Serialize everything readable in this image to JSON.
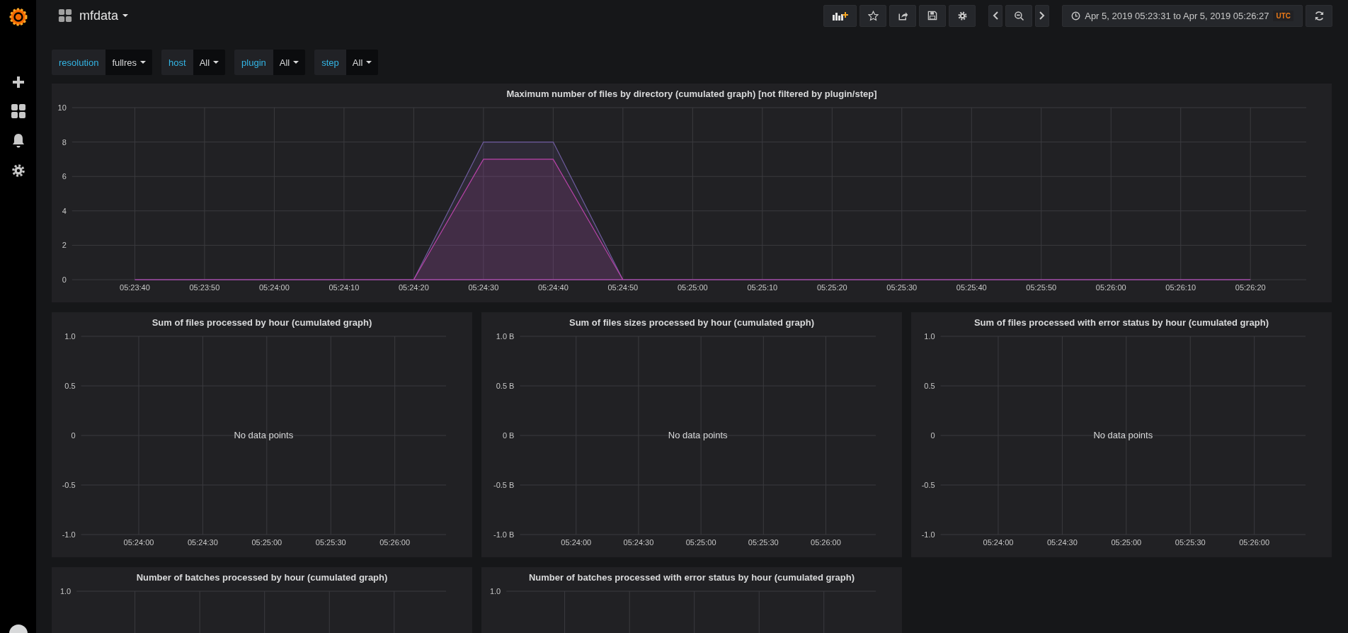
{
  "dashboard": {
    "title": "mfdata"
  },
  "toolbar": {
    "time_range": "Apr 5, 2019 05:23:31 to Apr 5, 2019 05:26:27",
    "timezone": "UTC"
  },
  "variables": [
    {
      "label": "resolution",
      "value": "fullres"
    },
    {
      "label": "host",
      "value": "All"
    },
    {
      "label": "plugin",
      "value": "All"
    },
    {
      "label": "step",
      "value": "All"
    }
  ],
  "panels": [
    {
      "title": "Maximum number of files by directory (cumulated graph) [not filtered by plugin/step]",
      "chart_data": {
        "type": "area",
        "grid": true,
        "categories": [
          "05:23:40",
          "05:23:50",
          "05:24:00",
          "05:24:10",
          "05:24:20",
          "05:24:30",
          "05:24:40",
          "05:24:50",
          "05:25:00",
          "05:25:10",
          "05:25:20",
          "05:25:30",
          "05:25:40",
          "05:25:50",
          "05:26:00",
          "05:26:10",
          "05:26:20"
        ],
        "ylim": [
          0,
          10
        ],
        "yticks": [
          0,
          2,
          4,
          6,
          8,
          10
        ],
        "series": [
          {
            "color": "#705da0",
            "values": [
              0,
              0,
              0,
              0,
              0,
              8,
              8,
              0,
              0,
              0,
              0,
              0,
              0,
              0,
              0,
              0,
              0
            ]
          },
          {
            "color": "#ba43a9",
            "values": [
              0,
              0,
              0,
              0,
              0,
              7,
              7,
              0,
              0,
              0,
              0,
              0,
              0,
              0,
              0,
              0,
              0
            ]
          }
        ]
      }
    },
    {
      "title": "Sum of files processed by hour (cumulated graph)",
      "message": "No data points",
      "chart_data": {
        "type": "line",
        "grid": true,
        "categories": [
          "05:24:00",
          "05:24:30",
          "05:25:00",
          "05:25:30",
          "05:26:00"
        ],
        "ylim": [
          -1,
          1
        ],
        "yticks": [
          {
            "value": 1,
            "label": "1.0"
          },
          {
            "value": 0.5,
            "label": "0.5"
          },
          {
            "value": 0,
            "label": "0"
          },
          {
            "value": -0.5,
            "label": "-0.5"
          },
          {
            "value": -1,
            "label": "-1.0"
          }
        ]
      }
    },
    {
      "title": "Sum of files sizes processed by hour (cumulated graph)",
      "message": "No data points",
      "chart_data": {
        "type": "line",
        "grid": true,
        "categories": [
          "05:24:00",
          "05:24:30",
          "05:25:00",
          "05:25:30",
          "05:26:00"
        ],
        "ylim": [
          -1,
          1
        ],
        "yticks": [
          {
            "value": 1,
            "label": "1.0 B"
          },
          {
            "value": 0.5,
            "label": "0.5 B"
          },
          {
            "value": 0,
            "label": "0 B"
          },
          {
            "value": -0.5,
            "label": "-0.5 B"
          },
          {
            "value": -1,
            "label": "-1.0 B"
          }
        ]
      }
    },
    {
      "title": "Sum of files processed with error status by hour (cumulated graph)",
      "message": "No data points",
      "chart_data": {
        "type": "line",
        "grid": true,
        "categories": [
          "05:24:00",
          "05:24:30",
          "05:25:00",
          "05:25:30",
          "05:26:00"
        ],
        "ylim": [
          -1,
          1
        ],
        "yticks": [
          {
            "value": 1,
            "label": "1.0"
          },
          {
            "value": 0.5,
            "label": "0.5"
          },
          {
            "value": 0,
            "label": "0"
          },
          {
            "value": -0.5,
            "label": "-0.5"
          },
          {
            "value": -1,
            "label": "-1.0"
          }
        ]
      }
    },
    {
      "title": "Number of batches processed by hour (cumulated graph)",
      "axis_label": "1.0"
    },
    {
      "title": "Number of batches processed with error status by hour (cumulated graph)",
      "axis_label": "1.0"
    }
  ]
}
